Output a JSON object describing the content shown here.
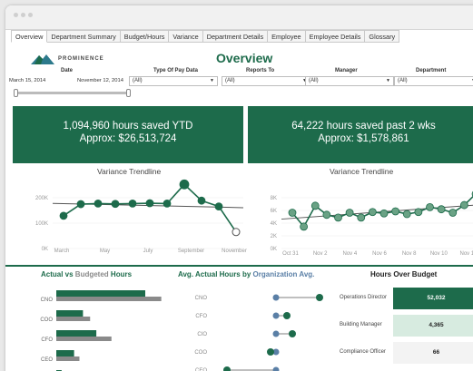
{
  "tabs": [
    "Overview",
    "Department Summary",
    "Budget/Hours",
    "Variance",
    "Department Details",
    "Employee",
    "Employee Details",
    "Glossary"
  ],
  "brand": {
    "name": "PROMINENCE"
  },
  "page_title": "Overview",
  "filters": {
    "date_label": "Date",
    "date_start": "March 15, 2014",
    "date_end": "November 12, 2014",
    "pay_type": {
      "label": "Type Of Pay Data",
      "value": "(All)"
    },
    "reports_to": {
      "label": "Reports To",
      "value": "(All)"
    },
    "manager": {
      "label": "Manager",
      "value": "(All)"
    },
    "department": {
      "label": "Department",
      "value": "(All)"
    }
  },
  "kpis": [
    {
      "line1": "1,094,960 hours saved YTD",
      "line2": "Approx: $26,513,724"
    },
    {
      "line1": "64,222 hours saved past 2 wks",
      "line2": "Approx: $1,578,861"
    }
  ],
  "sections": {
    "actual_vs_budgeted": {
      "part1": "Actual",
      "part2": " vs ",
      "part3": "Budgeted",
      "part4": " Hours"
    },
    "avg_actual": {
      "part1": "Avg. Actual Hours by ",
      "part2": "Organization Avg."
    },
    "hours_over_budget": {
      "title": "Hours Over Budget"
    }
  },
  "hours_over_budget": [
    {
      "name": "Operations Director",
      "value": "52,032",
      "color": "#1d6b4b",
      "text_color": "#ffffff"
    },
    {
      "name": "Building Manager",
      "value": "4,365",
      "color": "#d7ebe0",
      "text_color": "#222222"
    },
    {
      "name": "Compliance Officer",
      "value": "66",
      "color": "#f3f3f3",
      "text_color": "#222222"
    }
  ],
  "colors": {
    "primary": "#1d6b4b",
    "trend_line": "#555555",
    "budget_gray": "#8a8a8a",
    "org_avg": "#5a7fa6"
  },
  "chart_data": [
    {
      "type": "line",
      "title": "Variance Trendline",
      "categories": [
        "March",
        "May",
        "July",
        "September",
        "November"
      ],
      "series": [
        {
          "values": [
            20,
            120,
            125,
            122,
            125,
            128,
            125,
            290,
            150,
            100,
            -120
          ]
        }
      ],
      "yticks": [
        "200K",
        "100K",
        "0K"
      ],
      "ylim": [
        -200,
        300
      ],
      "trendline": true
    },
    {
      "type": "line",
      "title": "Variance Trendline",
      "categories": [
        "Oct 31",
        "Nov 2",
        "Nov 4",
        "Nov 6",
        "Nov 8",
        "Nov 10",
        "Nov 12"
      ],
      "series": [
        {
          "values": [
            4.5,
            2.5,
            5.5,
            4.2,
            3.8,
            4.5,
            3.8,
            4.6,
            4.4,
            4.7,
            4.3,
            4.6,
            5.3,
            5.0,
            4.5,
            5.6,
            7.2
          ]
        }
      ],
      "yticks": [
        "8K",
        "6K",
        "4K",
        "2K",
        "0K"
      ],
      "ylim": [
        0,
        9
      ],
      "trendline": true
    },
    {
      "type": "bar",
      "title": "Actual vs Budgeted Hours",
      "categories": [
        "CNO",
        "COO",
        "CFO",
        "CEO",
        "CIO"
      ],
      "series": [
        {
          "name": "Actual",
          "values": [
            100,
            30,
            45,
            20,
            6
          ]
        },
        {
          "name": "Budgeted",
          "values": [
            118,
            38,
            62,
            26,
            3
          ]
        }
      ]
    },
    {
      "type": "scatter",
      "title": "Avg. Actual Hours by Organization Avg.",
      "categories": [
        "CNO",
        "CFO",
        "CIO",
        "COO",
        "CEO"
      ],
      "series": [
        {
          "name": "Actual",
          "values": [
            95,
            65,
            70,
            50,
            10
          ]
        },
        {
          "name": "Organization Avg.",
          "values": [
            55,
            55,
            55,
            55,
            55
          ]
        }
      ]
    }
  ]
}
